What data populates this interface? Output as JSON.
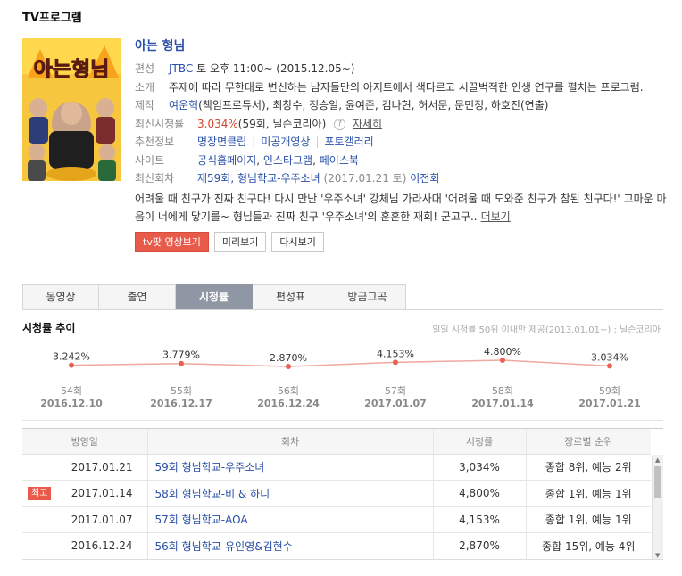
{
  "section_title": "TV프로그램",
  "program": {
    "title": "아는 형님",
    "poster_logo": "아는형님",
    "broadcast_label": "편성",
    "channel": "JTBC",
    "schedule": "토 오후 11:00~ (2015.12.05~)",
    "intro_label": "소개",
    "intro": "주제에 따라 무한대로 변신하는 남자들만의 아지트에서 색다르고 시끌벅적한 인생 연구를 펼치는 프로그램.",
    "production_label": "제작",
    "producer": "여운혁",
    "production_rest": "(책임프로듀서), 최창수, 정승일, 윤여준, 김나현, 허서문, 문민정, 하호진(연출)",
    "rating_label": "최신시청률",
    "rating_value": "3.034%",
    "rating_rest": "(59회, 닐슨코리아)",
    "help_icon": "?",
    "rating_detail_link": "자세히",
    "recommend_label": "추천정보",
    "recommend_links": [
      "명장면클립",
      "미공개영상",
      "포토갤러리"
    ],
    "site_label": "사이트",
    "site_links": [
      "공식홈페이지",
      "인스타그램",
      "페이스북"
    ],
    "latest_label": "최신회차",
    "latest_episode": "제59회, 형님학교-우주소녀",
    "latest_date": "(2017.01.21 토)",
    "prev_episode_link": "이전회",
    "latest_desc": "어려울 때 친구가 진짜 친구다! 다시 만난 '우주소녀' 강체님 가라사대 '어려울 때 도와준 친구가 참된 친구다!' 고마운 마음이 너에게 닿기를~ 형님들과 진짜 친구 '우주소녀'의 훈훈한 재회! 군고구..",
    "more_link": "더보기"
  },
  "buttons": {
    "watch": "tv팟 영상보기",
    "preview": "미리보기",
    "replay": "다시보기"
  },
  "tabs": [
    {
      "label": "동영상",
      "active": false
    },
    {
      "label": "출연",
      "active": false
    },
    {
      "label": "시청률",
      "active": true
    },
    {
      "label": "편성표",
      "active": false
    },
    {
      "label": "방금그곡",
      "active": false
    }
  ],
  "chart_section": {
    "title": "시청률 추이",
    "note": "일일 시청률 50위 이내만 제공(2013.01.01~) : 닐슨코리아"
  },
  "chart_data": {
    "type": "line",
    "categories": [
      "54회",
      "55회",
      "56회",
      "57회",
      "58회",
      "59회"
    ],
    "dates": [
      "2016.12.10",
      "2016.12.17",
      "2016.12.24",
      "2017.01.07",
      "2017.01.14",
      "2017.01.21"
    ],
    "values": [
      3.242,
      3.779,
      2.87,
      4.153,
      4.8,
      3.034
    ],
    "value_labels": [
      "3.242%",
      "3.779%",
      "2.870%",
      "4.153%",
      "4.800%",
      "3.034%"
    ],
    "unit": "%",
    "line_color": "#f0a8a0",
    "point_color": "#e8604f",
    "grid": false
  },
  "table": {
    "headers": [
      "방영일",
      "회차",
      "시청률",
      "장르별 순위"
    ],
    "rows": [
      {
        "date": "2017.01.21",
        "episode": "59회 형님학교-우주소녀",
        "rating": "3,034%",
        "rank": "종합 8위, 예능 2위",
        "badge": ""
      },
      {
        "date": "2017.01.14",
        "episode": "58회 형님학교-비 & 하니",
        "rating": "4,800%",
        "rank": "종합 1위, 예능 1위",
        "badge": "최고"
      },
      {
        "date": "2017.01.07",
        "episode": "57회 형님학교-AOA",
        "rating": "4,153%",
        "rank": "종합 1위, 예능 1위",
        "badge": ""
      },
      {
        "date": "2016.12.24",
        "episode": "56회 형님학교-유인영&김현수",
        "rating": "2,870%",
        "rank": "종합 15위, 예능 4위",
        "badge": ""
      }
    ]
  },
  "colors": {
    "link": "#2a50a8",
    "accent_red": "#e85a4a",
    "tab_active": "#8e97a3"
  }
}
